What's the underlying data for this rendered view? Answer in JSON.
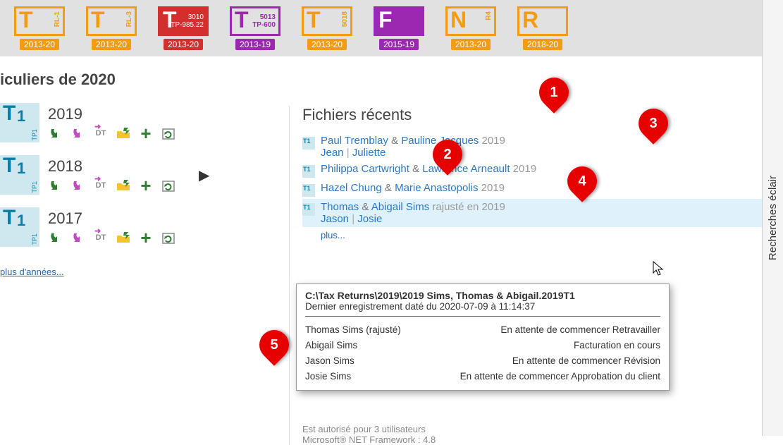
{
  "ribbon": {
    "tiles": [
      {
        "letter": "T",
        "small": "RL-1",
        "color": "orange",
        "year": "2013-20"
      },
      {
        "letter": "T",
        "small": "RL-3",
        "color": "orange",
        "year": "2013-20"
      },
      {
        "letter": "T",
        "small": "3010\nTP-985.22",
        "color": "red",
        "year": "2013-20"
      },
      {
        "letter": "T",
        "small": "5013\nTP-600",
        "color": "purple",
        "year": "2013-19"
      },
      {
        "letter": "T",
        "small": "5018",
        "color": "orange",
        "year": "2013-20"
      },
      {
        "letter": "F",
        "small": "",
        "color": "purplefill",
        "year": "2015-19"
      },
      {
        "letter": "N",
        "small": "R4",
        "color": "orange",
        "year": "2013-20"
      },
      {
        "letter": "R",
        "small": "",
        "color": "orange",
        "year": "2018-20"
      }
    ]
  },
  "sidebarTab": "Recherches éclair",
  "leftTitle": "iculiers de 2020",
  "years": [
    "2019",
    "2018",
    "2017"
  ],
  "moreYears": "plus d'années...",
  "recent": {
    "heading": "Fichiers récents",
    "items": [
      {
        "main": [
          "Paul Tremblay",
          "&",
          "Pauline Jacques"
        ],
        "year": "2019",
        "deps": [
          "Jean",
          "|",
          "Juliette"
        ]
      },
      {
        "main": [
          "Philippa Cartwright",
          "&",
          "Lawrence Arneault"
        ],
        "year": "2019"
      },
      {
        "main": [
          "Hazel Chung",
          "&",
          "Marie Anastopolis"
        ],
        "year": "2019"
      },
      {
        "main": [
          "Thomas",
          "&",
          "Abigail Sims"
        ],
        "year": "rajusté en 2019",
        "deps": [
          "Jason",
          "|",
          "Josie"
        ],
        "hl": true
      }
    ],
    "more": "plus..."
  },
  "tooltip": {
    "path": "C:\\Tax Returns\\2019\\2019 Sims, Thomas & Abigail.2019T1",
    "saved": "Dernier enregistrement daté du 2020-07-09 à 11:14:37",
    "rows": [
      {
        "name": "Thomas Sims (rajusté)",
        "status": "En attente de commencer Retravailler"
      },
      {
        "name": "Abigail Sims",
        "status": "Facturation en cours"
      },
      {
        "name": "Jason Sims",
        "status": "En attente de commencer Révision"
      },
      {
        "name": "Josie Sims",
        "status": "En attente de commencer Approbation du client"
      }
    ]
  },
  "license": {
    "line1": "Est autorisé pour 3 utilisateurs",
    "line2": "Microsoft®  NET Framework : 4.8"
  },
  "pins": {
    "1": "1",
    "2": "2",
    "3": "3",
    "4": "4",
    "5": "5"
  }
}
